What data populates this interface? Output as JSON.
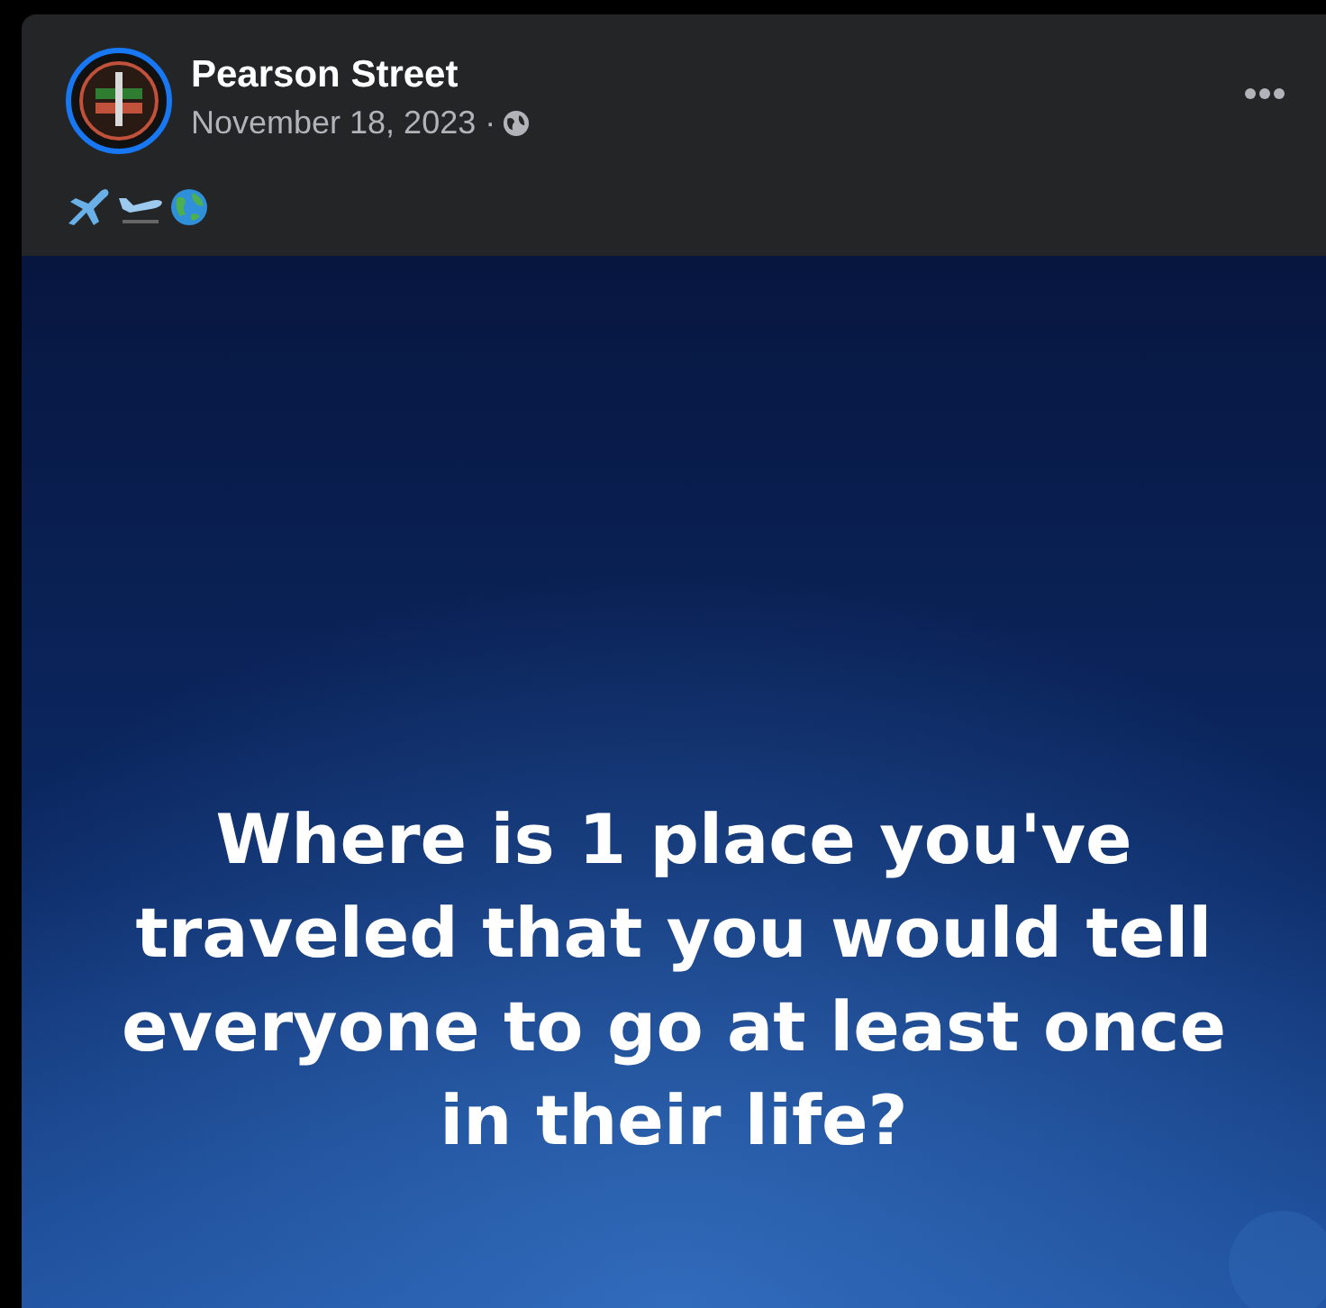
{
  "post": {
    "author": "Pearson Street",
    "date": "November 18, 2023 ·"
  },
  "image": {
    "text": "Where is 1 place you've traveled that you would tell everyone to go at least once in their life?"
  }
}
